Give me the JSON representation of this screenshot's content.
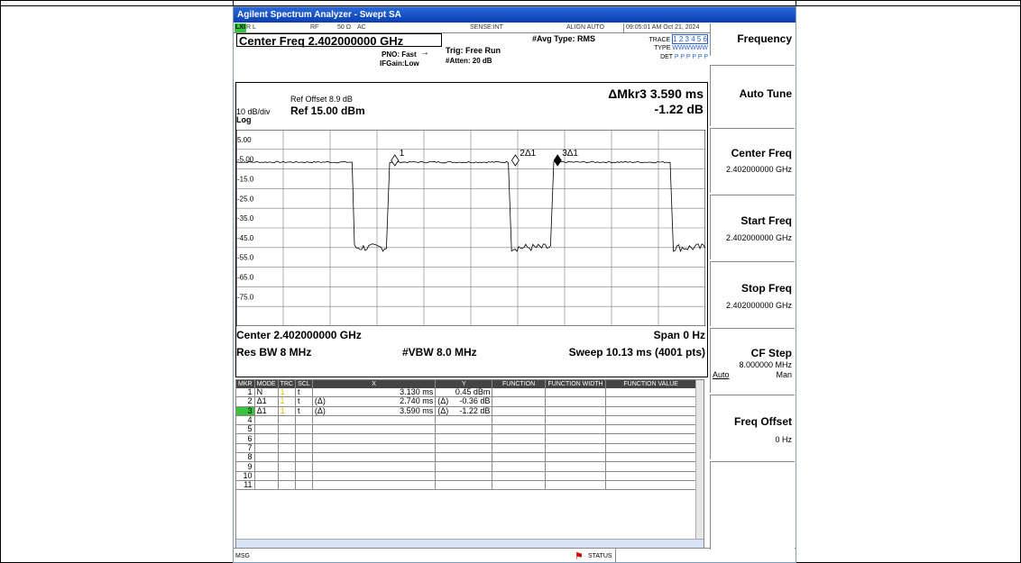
{
  "window": {
    "title": "Agilent Spectrum Analyzer - Swept SA"
  },
  "status_bar": {
    "badge": "LXI",
    "rl": "R L",
    "rf": "RF",
    "impedance": "50 Ω",
    "coupling": "AC",
    "sense": "SENSE:INT",
    "align": "ALIGN AUTO",
    "datetime": "09:05:01 AM Oct 21, 2024"
  },
  "header": {
    "center_freq": "Center Freq 2.402000000 GHz",
    "pno": "PNO: Fast",
    "ifgain": "IFGain:Low",
    "trig": "Trig: Free Run",
    "atten": "#Atten: 20 dB",
    "avg_type": "#Avg Type: RMS",
    "trace_label": "TRACE",
    "trace_nums": "1 2 3 4 5 6",
    "type_label": "TYPE",
    "type_vals": "WWWWWW",
    "det_label": "DET",
    "det_vals": "P P P P P P"
  },
  "screen": {
    "ref_offset": "Ref Offset 8.9 dB",
    "ref_level": "Ref 15.00 dBm",
    "scale": "10 dB/div",
    "log": "Log",
    "marker_title": "ΔMkr3 3.590 ms",
    "marker_value": "-1.22 dB",
    "y_ticks": [
      "5.00",
      "-5.00",
      "-15.0",
      "-25.0",
      "-35.0",
      "-45.0",
      "-55.0",
      "-65.0",
      "-75.0"
    ],
    "marker_labels": [
      "1",
      "2Δ1",
      "3Δ1"
    ],
    "center": "Center 2.402000000 GHz",
    "span": "Span 0 Hz",
    "res_bw": "Res BW 8 MHz",
    "vbw": "#VBW 8.0 MHz",
    "sweep": "Sweep  10.13 ms (4001 pts)"
  },
  "softkeys": {
    "menu_title": "Frequency",
    "auto_tune": "Auto Tune",
    "center_freq": {
      "label": "Center Freq",
      "value": "2.402000000 GHz"
    },
    "start_freq": {
      "label": "Start Freq",
      "value": "2.402000000 GHz"
    },
    "stop_freq": {
      "label": "Stop Freq",
      "value": "2.402000000 GHz"
    },
    "cf_step": {
      "label": "CF Step",
      "value": "8.000000 MHz",
      "auto": "Auto",
      "man": "Man"
    },
    "freq_offset": {
      "label": "Freq Offset",
      "value": "0 Hz"
    }
  },
  "marker_table": {
    "headers": [
      "MKR",
      "MODE",
      "TRC",
      "SCL",
      "X",
      "Y",
      "FUNCTION",
      "FUNCTION WIDTH",
      "FUNCTION VALUE"
    ],
    "rows": [
      {
        "mkr": "1",
        "mode": "N",
        "trc": "1",
        "scl": "t",
        "xmode": "",
        "x": "3.130 ms",
        "ymode": "",
        "y": "0.45 dBm"
      },
      {
        "mkr": "2",
        "mode": "Δ1",
        "trc": "1",
        "scl": "t",
        "xmode": "(Δ)",
        "x": "2.740 ms",
        "ymode": "(Δ)",
        "y": "-0.36 dB"
      },
      {
        "mkr": "3",
        "mode": "Δ1",
        "trc": "1",
        "scl": "t",
        "xmode": "(Δ)",
        "x": "3.590 ms",
        "ymode": "(Δ)",
        "y": "-1.22 dB"
      },
      {
        "mkr": "4"
      },
      {
        "mkr": "5"
      },
      {
        "mkr": "6"
      },
      {
        "mkr": "7"
      },
      {
        "mkr": "8"
      },
      {
        "mkr": "9"
      },
      {
        "mkr": "10"
      },
      {
        "mkr": "11"
      }
    ]
  },
  "message_bar": {
    "msg": "MSG",
    "status": "STATUS"
  },
  "colors": {
    "titlebar": "#0a3fb1",
    "marker_active": "#39c13f",
    "trace": "#000000"
  }
}
